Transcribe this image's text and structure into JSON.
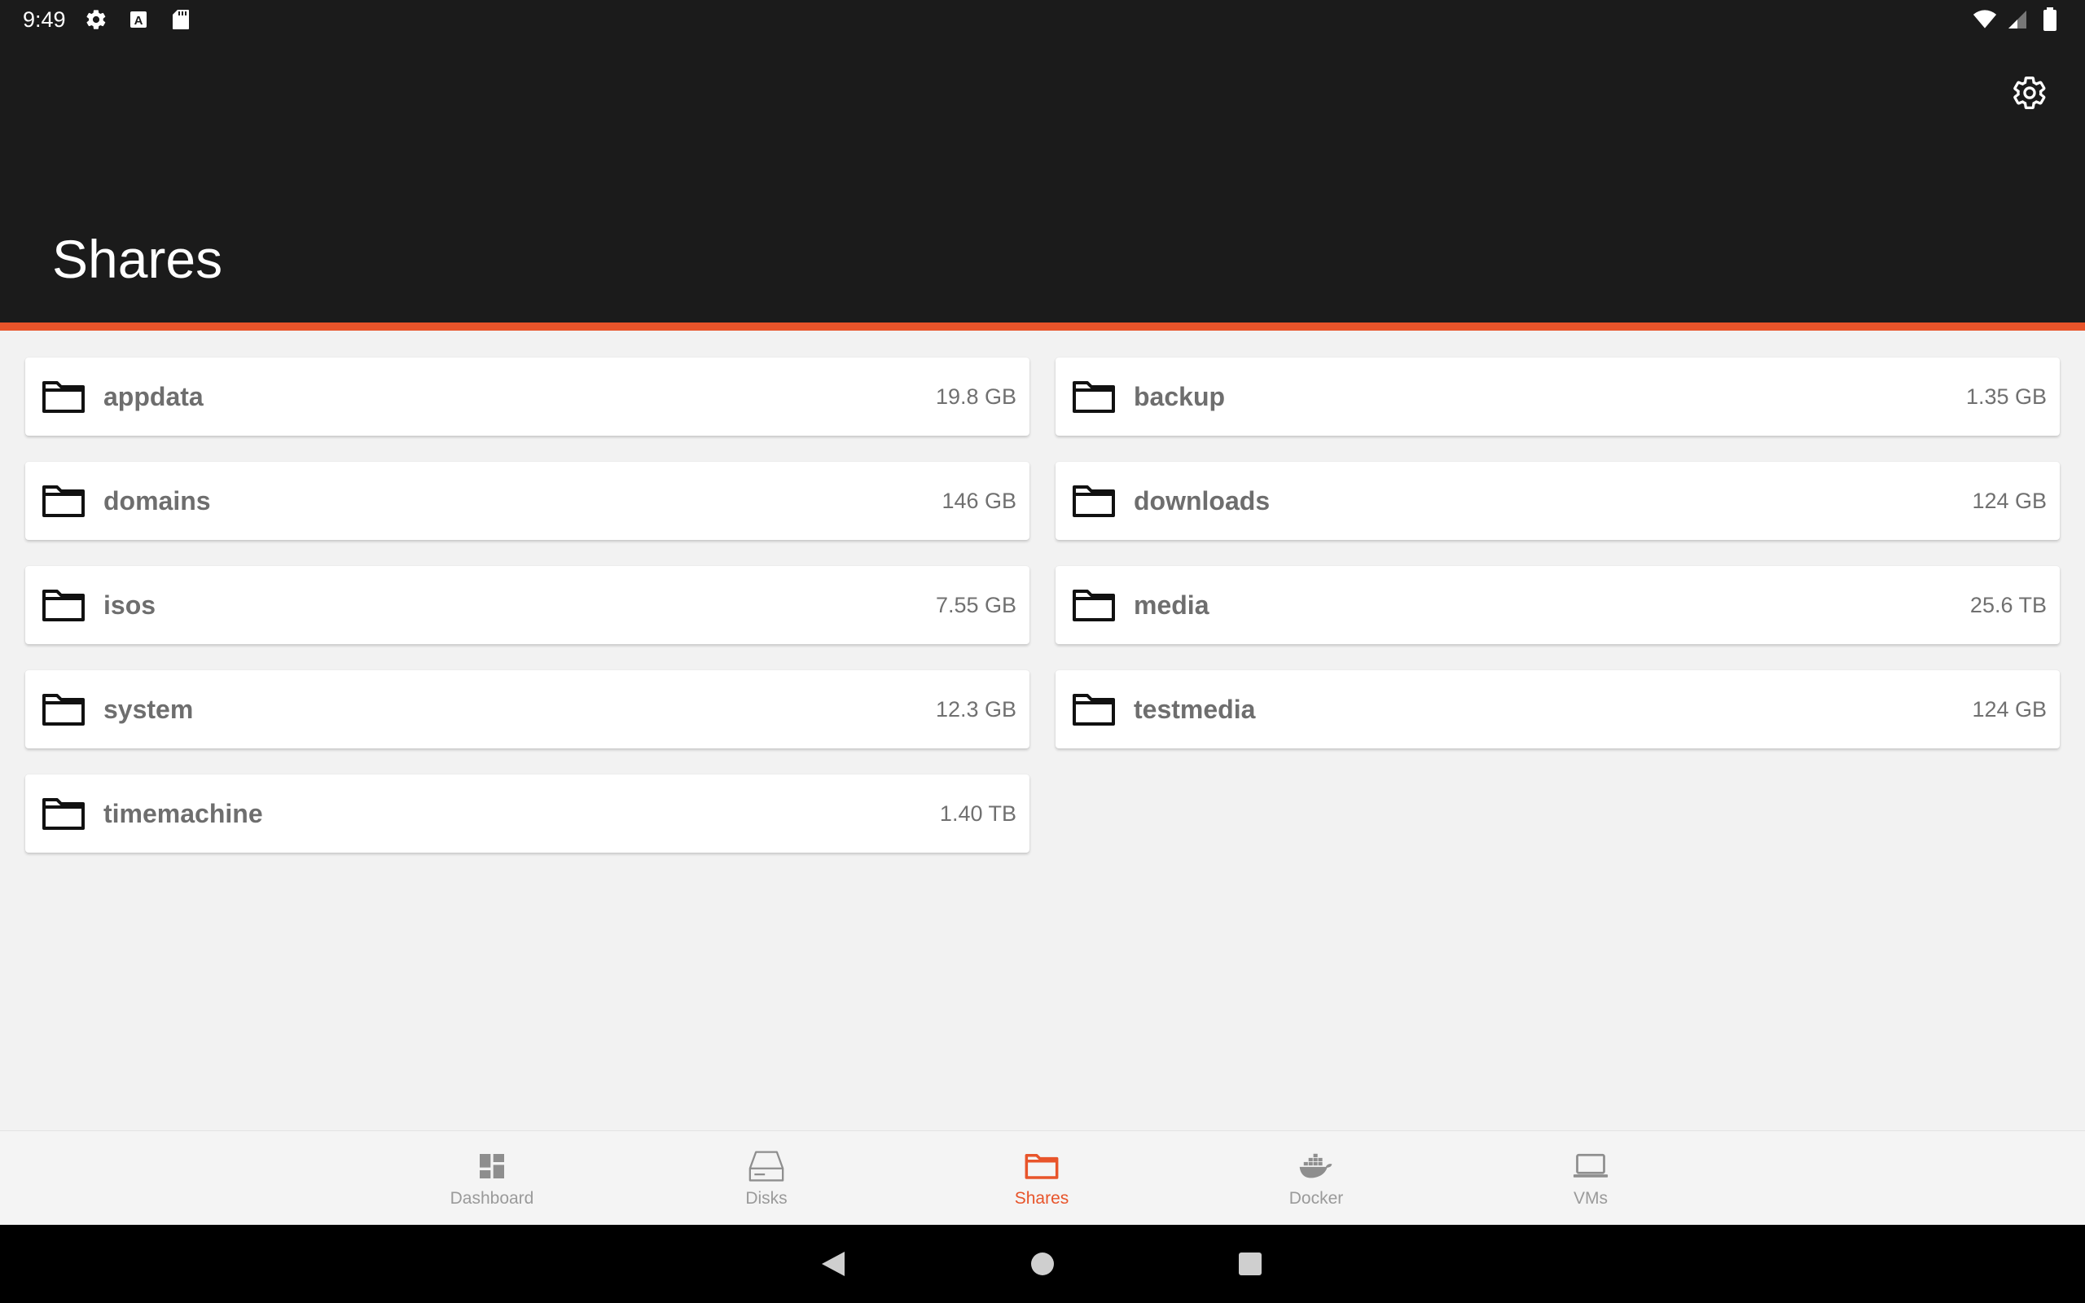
{
  "status_bar": {
    "time": "9:49",
    "left_icons": [
      "gear-icon",
      "keyboard-a-icon",
      "sd-card-icon"
    ],
    "right_icons": [
      "wifi-icon",
      "signal-icon",
      "battery-icon"
    ]
  },
  "header": {
    "title": "Shares",
    "settings_icon": "gear-icon"
  },
  "colors": {
    "accent": "#e8542a",
    "header_bg": "#1b1b1b",
    "content_bg": "#f2f2f2"
  },
  "shares": [
    {
      "name": "appdata",
      "size": "19.8 GB"
    },
    {
      "name": "backup",
      "size": "1.35 GB"
    },
    {
      "name": "domains",
      "size": "146 GB"
    },
    {
      "name": "downloads",
      "size": "124 GB"
    },
    {
      "name": "isos",
      "size": "7.55 GB"
    },
    {
      "name": "media",
      "size": "25.6 TB"
    },
    {
      "name": "system",
      "size": "12.3 GB"
    },
    {
      "name": "testmedia",
      "size": "124 GB"
    },
    {
      "name": "timemachine",
      "size": "1.40 TB"
    }
  ],
  "bottom_nav": {
    "items": [
      {
        "label": "Dashboard",
        "icon": "dashboard-icon"
      },
      {
        "label": "Disks",
        "icon": "disk-icon"
      },
      {
        "label": "Shares",
        "icon": "folder-icon",
        "active": true
      },
      {
        "label": "Docker",
        "icon": "docker-icon"
      },
      {
        "label": "VMs",
        "icon": "laptop-icon"
      }
    ]
  },
  "system_nav": [
    "back-icon",
    "home-icon",
    "recents-icon"
  ]
}
